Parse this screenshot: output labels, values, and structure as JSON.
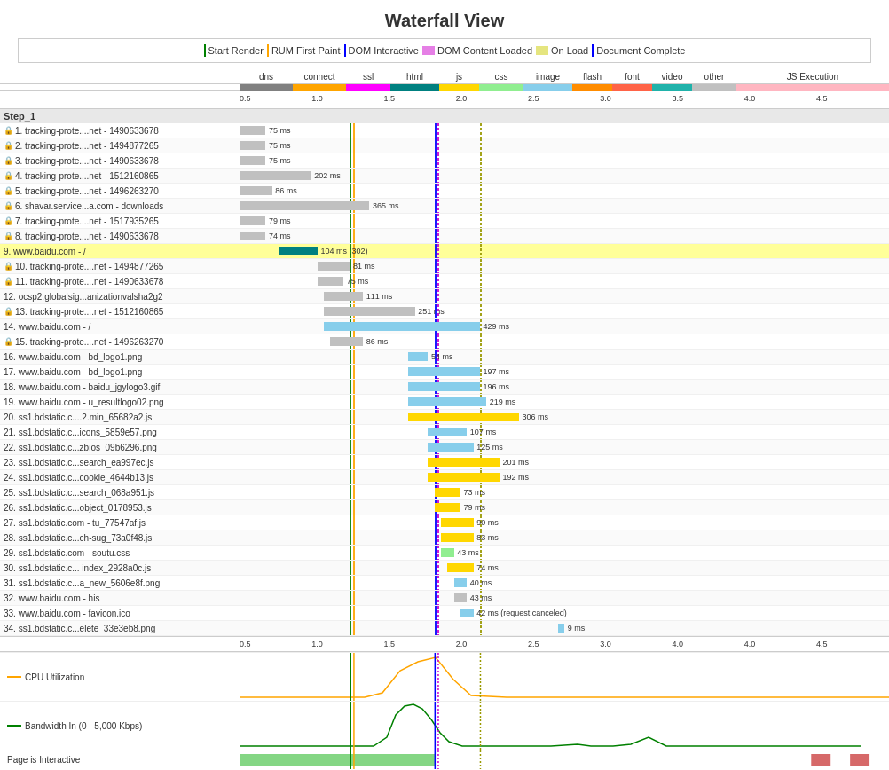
{
  "title": "Waterfall View",
  "legend": {
    "items": [
      {
        "id": "start-render",
        "label": "Start Render",
        "type": "line",
        "color": "#008000"
      },
      {
        "id": "rum-first-paint",
        "label": "RUM First Paint",
        "type": "line",
        "color": "#FFA500"
      },
      {
        "id": "dom-interactive",
        "label": "DOM Interactive",
        "type": "line",
        "color": "#0000FF"
      },
      {
        "id": "dom-content-loaded",
        "label": "DOM Content Loaded",
        "type": "box",
        "color": "#CC00CC"
      },
      {
        "id": "on-load",
        "label": "On Load",
        "type": "box",
        "color": "#CCCC00"
      },
      {
        "id": "document-complete",
        "label": "Document Complete",
        "type": "line",
        "color": "#0000FF"
      }
    ]
  },
  "resource_types": [
    {
      "label": "dns",
      "color": "#808080"
    },
    {
      "label": "connect",
      "color": "#FFA500"
    },
    {
      "label": "ssl",
      "color": "#FF00FF"
    },
    {
      "label": "html",
      "color": "#008080"
    },
    {
      "label": "js",
      "color": "#FFD700"
    },
    {
      "label": "css",
      "color": "#90EE90"
    },
    {
      "label": "image",
      "color": "#87CEEB"
    },
    {
      "label": "flash",
      "color": "#FF8C00"
    },
    {
      "label": "font",
      "color": "#FF6347"
    },
    {
      "label": "video",
      "color": "#20B2AA"
    },
    {
      "label": "other",
      "color": "#C0C0C0"
    },
    {
      "label": "JS Execution",
      "color": "#FFB6C1"
    }
  ],
  "step": "Step_1",
  "requests": [
    {
      "id": 1,
      "name": "tracking-prote....net - 1490633678",
      "secure": true,
      "time": "75 ms",
      "bar_left_pct": 0,
      "bar_width_pct": 4,
      "bar_color": "#C0C0C0"
    },
    {
      "id": 2,
      "name": "tracking-prote....net - 1494877265",
      "secure": true,
      "time": "75 ms",
      "bar_left_pct": 0,
      "bar_width_pct": 4,
      "bar_color": "#C0C0C0"
    },
    {
      "id": 3,
      "name": "tracking-prote....net - 1490633678",
      "secure": true,
      "time": "75 ms",
      "bar_left_pct": 0,
      "bar_width_pct": 4,
      "bar_color": "#C0C0C0"
    },
    {
      "id": 4,
      "name": "tracking-prote....net - 1512160865",
      "secure": true,
      "time": "202 ms",
      "bar_left_pct": 0,
      "bar_width_pct": 11,
      "bar_color": "#C0C0C0"
    },
    {
      "id": 5,
      "name": "tracking-prote....net - 1496263270",
      "secure": true,
      "time": "86 ms",
      "bar_left_pct": 0,
      "bar_width_pct": 5,
      "bar_color": "#C0C0C0"
    },
    {
      "id": 6,
      "name": "shavar.service...a.com - downloads",
      "secure": true,
      "time": "365 ms",
      "bar_left_pct": 0,
      "bar_width_pct": 20,
      "bar_color": "#C0C0C0"
    },
    {
      "id": 7,
      "name": "tracking-prote....net - 1517935265",
      "secure": true,
      "time": "79 ms",
      "bar_left_pct": 0,
      "bar_width_pct": 4,
      "bar_color": "#C0C0C0"
    },
    {
      "id": 8,
      "name": "tracking-prote....net - 1490633678",
      "secure": true,
      "time": "74 ms",
      "bar_left_pct": 0,
      "bar_width_pct": 4,
      "bar_color": "#C0C0C0"
    },
    {
      "id": 9,
      "name": "www.baidu.com - /",
      "secure": false,
      "time": "104 ms (302)",
      "bar_left_pct": 6,
      "bar_width_pct": 6,
      "bar_color": "#008080",
      "highlighted": true
    },
    {
      "id": 10,
      "name": "tracking-prote....net - 1494877265",
      "secure": true,
      "time": "81 ms",
      "bar_left_pct": 12,
      "bar_width_pct": 5,
      "bar_color": "#C0C0C0"
    },
    {
      "id": 11,
      "name": "tracking-prote....net - 1490633678",
      "secure": true,
      "time": "75 ms",
      "bar_left_pct": 12,
      "bar_width_pct": 4,
      "bar_color": "#C0C0C0"
    },
    {
      "id": 12,
      "name": "ocsp2.globalsig...anizationvalsha2g2",
      "secure": false,
      "time": "111 ms",
      "bar_left_pct": 13,
      "bar_width_pct": 6,
      "bar_color": "#C0C0C0"
    },
    {
      "id": 13,
      "name": "tracking-prote....net - 1512160865",
      "secure": true,
      "time": "251 ms",
      "bar_left_pct": 13,
      "bar_width_pct": 14,
      "bar_color": "#C0C0C0"
    },
    {
      "id": 14,
      "name": "www.baidu.com - /",
      "secure": false,
      "time": "429 ms",
      "bar_left_pct": 13,
      "bar_width_pct": 24,
      "bar_color": "#87CEEB"
    },
    {
      "id": 15,
      "name": "tracking-prote....net - 1496263270",
      "secure": true,
      "time": "86 ms",
      "bar_left_pct": 14,
      "bar_width_pct": 5,
      "bar_color": "#C0C0C0"
    },
    {
      "id": 16,
      "name": "www.baidu.com - bd_logo1.png",
      "secure": false,
      "time": "54 ms",
      "bar_left_pct": 26,
      "bar_width_pct": 3,
      "bar_color": "#87CEEB"
    },
    {
      "id": 17,
      "name": "www.baidu.com - bd_logo1.png",
      "secure": false,
      "time": "197 ms",
      "bar_left_pct": 26,
      "bar_width_pct": 11,
      "bar_color": "#87CEEB"
    },
    {
      "id": 18,
      "name": "www.baidu.com - baidu_jgylogo3.gif",
      "secure": false,
      "time": "196 ms",
      "bar_left_pct": 26,
      "bar_width_pct": 11,
      "bar_color": "#87CEEB"
    },
    {
      "id": 19,
      "name": "www.baidu.com - u_resultlogo02.png",
      "secure": false,
      "time": "219 ms",
      "bar_left_pct": 26,
      "bar_width_pct": 12,
      "bar_color": "#87CEEB"
    },
    {
      "id": 20,
      "name": "ss1.bdstatic.c....2.min_65682a2.js",
      "secure": false,
      "time": "306 ms",
      "bar_left_pct": 26,
      "bar_width_pct": 17,
      "bar_color": "#FFD700"
    },
    {
      "id": 21,
      "name": "ss1.bdstatic.c...icons_5859e57.png",
      "secure": false,
      "time": "107 ms",
      "bar_left_pct": 29,
      "bar_width_pct": 6,
      "bar_color": "#87CEEB"
    },
    {
      "id": 22,
      "name": "ss1.bdstatic.c...zbios_09b6296.png",
      "secure": false,
      "time": "125 ms",
      "bar_left_pct": 29,
      "bar_width_pct": 7,
      "bar_color": "#87CEEB"
    },
    {
      "id": 23,
      "name": "ss1.bdstatic.c...search_ea997ec.js",
      "secure": false,
      "time": "201 ms",
      "bar_left_pct": 29,
      "bar_width_pct": 11,
      "bar_color": "#FFD700"
    },
    {
      "id": 24,
      "name": "ss1.bdstatic.c...cookie_4644b13.js",
      "secure": false,
      "time": "192 ms",
      "bar_left_pct": 29,
      "bar_width_pct": 11,
      "bar_color": "#FFD700"
    },
    {
      "id": 25,
      "name": "ss1.bdstatic.c...search_068a951.js",
      "secure": false,
      "time": "73 ms",
      "bar_left_pct": 30,
      "bar_width_pct": 4,
      "bar_color": "#FFD700"
    },
    {
      "id": 26,
      "name": "ss1.bdstatic.c...object_0178953.js",
      "secure": false,
      "time": "79 ms",
      "bar_left_pct": 30,
      "bar_width_pct": 4,
      "bar_color": "#FFD700"
    },
    {
      "id": 27,
      "name": "ss1.bdstatic.com - tu_77547af.js",
      "secure": false,
      "time": "90 ms",
      "bar_left_pct": 31,
      "bar_width_pct": 5,
      "bar_color": "#FFD700"
    },
    {
      "id": 28,
      "name": "ss1.bdstatic.c...ch-sug_73a0f48.js",
      "secure": false,
      "time": "83 ms",
      "bar_left_pct": 31,
      "bar_width_pct": 5,
      "bar_color": "#FFD700"
    },
    {
      "id": 29,
      "name": "ss1.bdstatic.com - soutu.css",
      "secure": false,
      "time": "43 ms",
      "bar_left_pct": 31,
      "bar_width_pct": 2,
      "bar_color": "#90EE90"
    },
    {
      "id": 30,
      "name": "ss1.bdstatic.c... index_2928a0c.js",
      "secure": false,
      "time": "74 ms",
      "bar_left_pct": 32,
      "bar_width_pct": 4,
      "bar_color": "#FFD700"
    },
    {
      "id": 31,
      "name": "ss1.bdstatic.c...a_new_5606e8f.png",
      "secure": false,
      "time": "40 ms",
      "bar_left_pct": 33,
      "bar_width_pct": 2,
      "bar_color": "#87CEEB"
    },
    {
      "id": 32,
      "name": "www.baidu.com - his",
      "secure": false,
      "time": "43 ms",
      "bar_left_pct": 33,
      "bar_width_pct": 2,
      "bar_color": "#C0C0C0"
    },
    {
      "id": 33,
      "name": "www.baidu.com - favicon.ico",
      "secure": false,
      "time": "42 ms (request canceled)",
      "bar_left_pct": 34,
      "bar_width_pct": 2,
      "bar_color": "#87CEEB"
    },
    {
      "id": 34,
      "name": "ss1.bdstatic.c...elete_33e3eb8.png",
      "secure": false,
      "time": "9 ms",
      "bar_left_pct": 49,
      "bar_width_pct": 1,
      "bar_color": "#87CEEB"
    }
  ],
  "timeline_ticks": [
    "0.5",
    "1.0",
    "1.5",
    "2.0",
    "2.5",
    "3.0",
    "3.5",
    "4.0",
    "4.5"
  ],
  "markers": {
    "start_render": {
      "pct": 17,
      "color": "#008000"
    },
    "rum_first_paint": {
      "pct": 17.5,
      "color": "#FFA500"
    },
    "dom_interactive": {
      "pct": 30,
      "color": "#0000FF"
    },
    "dom_content_loaded": {
      "pct": 30.5,
      "color": "#CC00CC"
    },
    "on_load": {
      "pct": 37,
      "color": "#CCCC00"
    }
  },
  "charts": {
    "cpu_label": "CPU Utilization",
    "bandwidth_label": "Bandwidth In (0 - 5,000 Kbps)",
    "interactive_label": "Page is Interactive"
  }
}
